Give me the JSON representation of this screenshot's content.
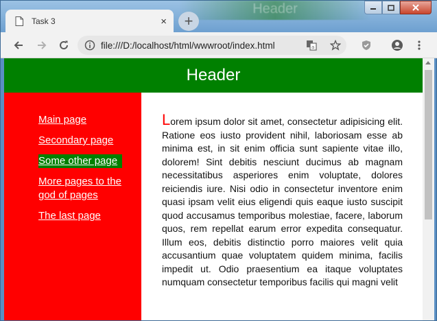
{
  "browser": {
    "tab_title": "Task 3",
    "tab_close": "×",
    "new_tab": "+",
    "url": "file:///D:/localhost/html/wwwroot/index.html",
    "background_title": "Header"
  },
  "icons": {
    "back": "back-arrow-icon",
    "forward": "forward-arrow-icon",
    "reload": "reload-icon",
    "info": "info-icon",
    "translate": "translate-icon",
    "bookmark": "star-icon",
    "shield": "shield-icon",
    "account": "account-icon",
    "menu": "kebab-menu-icon"
  },
  "colors": {
    "header_bg": "#008000",
    "sidebar_bg": "#ff0000",
    "active_link_bg": "#008000"
  },
  "page": {
    "header": "Header",
    "nav": [
      {
        "label": "Main page"
      },
      {
        "label": "Secondary page"
      },
      {
        "label": "Some other page",
        "active": true
      },
      {
        "label": "More pages to the god of pages"
      },
      {
        "label": "The last page"
      }
    ],
    "dropcap": "L",
    "body": "orem ipsum dolor sit amet, consectetur adipisicing elit. Ratione eos iusto provident nihil, laboriosam esse ab minima est, in sit enim officia sunt sapiente vitae illo, dolorem! Sint debitis nesciunt ducimus ab magnam necessitatibus asperiores enim voluptate, dolores reiciendis iure. Nisi odio in consectetur inventore enim quasi ipsam velit eius eligendi quis eaque iusto suscipit quod accusamus temporibus molestiae, facere, laborum quos, rem repellat earum error expedita consequatur. Illum eos, debitis distinctio porro maiores velit quia accusantium quae voluptatem quidem minima, facilis impedit ut. Odio praesentium ea itaque voluptates numquam consectetur temporibus facilis qui magni velit"
  }
}
